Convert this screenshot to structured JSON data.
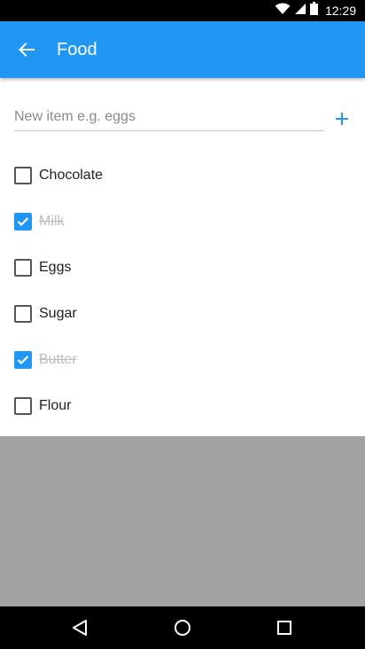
{
  "status_bar": {
    "time": "12:29",
    "icons": [
      "wifi-icon",
      "signal-icon",
      "battery-icon"
    ]
  },
  "app_bar": {
    "title": "Food",
    "color": "#2196f3"
  },
  "new_item": {
    "value": "",
    "placeholder": "New item e.g. eggs"
  },
  "items": [
    {
      "label": "Chocolate",
      "checked": false
    },
    {
      "label": "Milk",
      "checked": true
    },
    {
      "label": "Eggs",
      "checked": false
    },
    {
      "label": "Sugar",
      "checked": false
    },
    {
      "label": "Butter",
      "checked": true
    },
    {
      "label": "Flour",
      "checked": false
    }
  ],
  "nav_bar": {
    "buttons": [
      "back-triangle-icon",
      "home-circle-icon",
      "recents-square-icon"
    ]
  }
}
